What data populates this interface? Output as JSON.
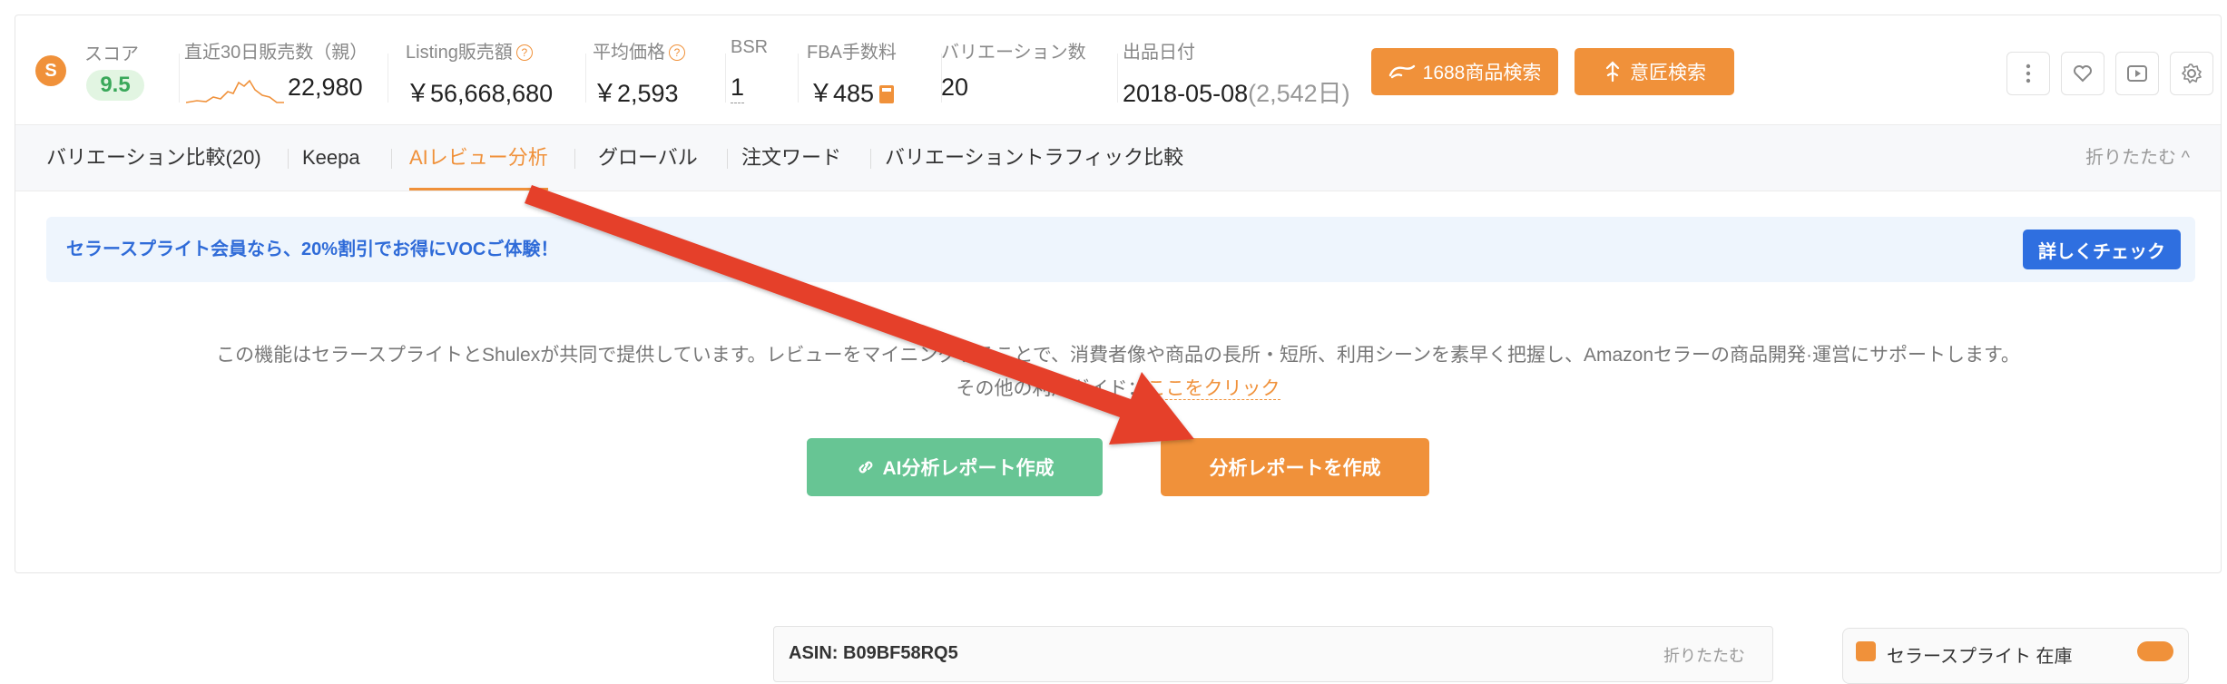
{
  "metrics": {
    "score_label": "スコア",
    "score_value": "9.5",
    "sales30_label": "直近30日販売数（親）",
    "sales30_value": "22,980",
    "listing_sales_label": "Listing販売額",
    "listing_sales_value": "￥56,668,680",
    "avg_price_label": "平均価格",
    "avg_price_value": "￥2,593",
    "bsr_label": "BSR",
    "bsr_value": "1",
    "fba_label": "FBA手数料",
    "fba_value": "￥485",
    "variations_label": "バリエーション数",
    "variations_value": "20",
    "listing_date_label": "出品日付",
    "listing_date_value": "2018-05-08",
    "listing_days": "(2,542日)",
    "help_icon": "?",
    "icons": [
      "more-vertical-icon",
      "heart-icon",
      "play-video-icon",
      "settings-icon"
    ]
  },
  "actions": {
    "search_1688": "1688商品検索",
    "artisan_search": "意匠検索"
  },
  "tabs": [
    {
      "label": "バリエーション比較(20)"
    },
    {
      "label": "Keepa"
    },
    {
      "label": "AIレビュー分析"
    },
    {
      "label": "グローバル"
    },
    {
      "label": "注文ワード"
    },
    {
      "label": "バリエーショントラフィック比較"
    }
  ],
  "collapse_label": "折りたたむ ^",
  "notice": {
    "text": "セラースプライト会員なら、20%割引でお得にVOCご体験！",
    "button": "詳しくチェック"
  },
  "description": {
    "line1": "この機能はセラースプライトとShulexが共同で提供しています。レビューをマイニングすることで、消費者像や商品の長所・短所、利用シーンを素早く把握し、Amazonセラーの商品開発·運営にサポートします。",
    "line2_prefix": "その他の利用ガイド：",
    "line2_link": "ここをクリック"
  },
  "buttons": {
    "ai_report": "AI分析レポート作成",
    "create_report": "分析レポートを作成"
  },
  "bottom": {
    "asin_text": "ASIN: B09BF58RQ5",
    "asin_right": "折りたたむ",
    "side_text": "セラースプライト 在庫"
  },
  "colors": {
    "accent_orange": "#f0913a",
    "green": "#67c594",
    "blue": "#2f6fe0",
    "arrow_red": "#e53f2a"
  }
}
